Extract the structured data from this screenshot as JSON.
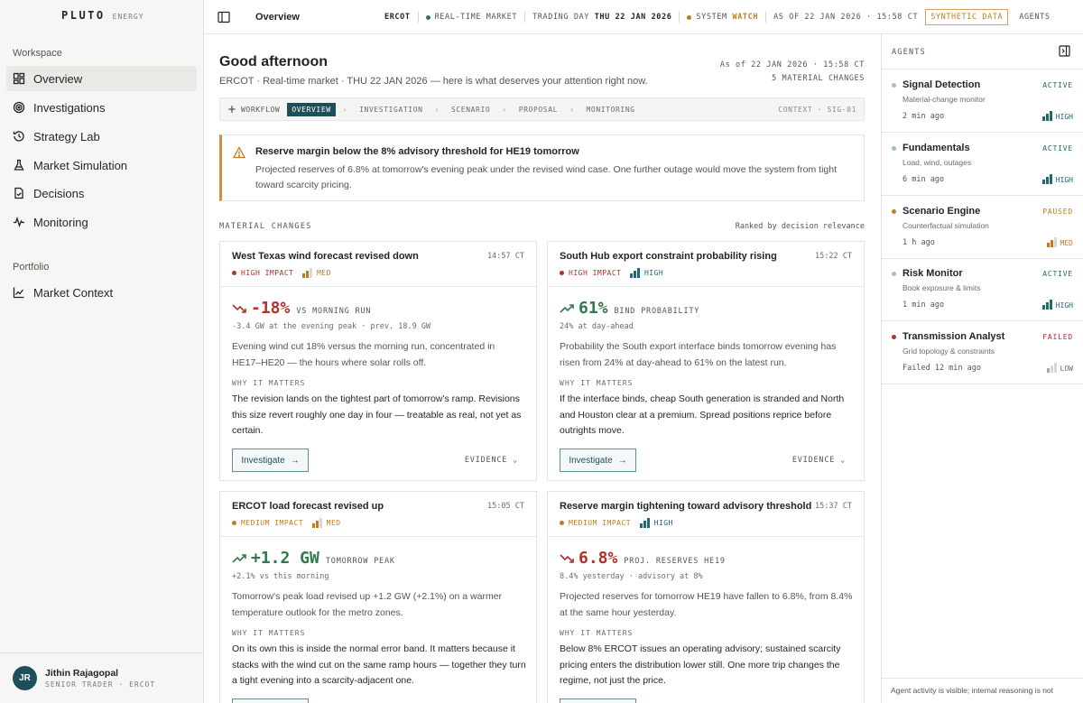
{
  "brand": {
    "name": "PLUTO",
    "sub": "ENERGY"
  },
  "sidebar": {
    "workspace_label": "Workspace",
    "portfolio_label": "Portfolio",
    "items": [
      {
        "label": "Overview",
        "icon": "grid-icon"
      },
      {
        "label": "Investigations",
        "icon": "target-icon"
      },
      {
        "label": "Strategy Lab",
        "icon": "history-icon"
      },
      {
        "label": "Market Simulation",
        "icon": "flask-icon"
      },
      {
        "label": "Decisions",
        "icon": "document-check-icon"
      },
      {
        "label": "Monitoring",
        "icon": "pulse-icon"
      }
    ],
    "portfolio_items": [
      {
        "label": "Market Context",
        "icon": "line-chart-icon"
      }
    ],
    "user": {
      "initials": "JR",
      "name": "Jithin Rajagopal",
      "role": "SENIOR TRADER · ERCOT"
    }
  },
  "topbar": {
    "title": "Overview",
    "market": "ERCOT",
    "realtime": "REAL-TIME MARKET",
    "trading_day_label": "TRADING DAY",
    "trading_day": "THU 22 JAN 2026",
    "system_label": "SYSTEM",
    "system_state": "WATCH",
    "as_of": "AS OF 22 JAN 2026 · 15:58 CT",
    "synthetic": "SYNTHETIC DATA",
    "agents": "AGENTS",
    "colors": {
      "live": "#2d7a4a",
      "watch": "#c07d1e"
    }
  },
  "main": {
    "greeting": "Good afternoon",
    "subtitle": "ERCOT · Real-time market · THU 22 JAN 2026 — here is what deserves your attention right now.",
    "as_of": "As of 22 JAN 2026 · 15:58 CT",
    "changes_count": "5 MATERIAL CHANGES",
    "workflow": {
      "label": "WORKFLOW",
      "steps": [
        "OVERVIEW",
        "INVESTIGATION",
        "SCENARIO",
        "PROPOSAL",
        "MONITORING"
      ],
      "context": "CONTEXT · SIG-01"
    },
    "alert": {
      "title": "Reserve margin below the 8% advisory threshold for HE19 tomorrow",
      "body": "Projected reserves of 6.8% at tomorrow's evening peak under the revised wind case. One further outage would move the system from tight toward scarcity pricing."
    },
    "section_title": "MATERIAL CHANGES",
    "section_sort": "Ranked by decision relevance",
    "why_label": "WHY IT MATTERS",
    "investigate_label": "Investigate",
    "evidence_label": "EVIDENCE",
    "cards": [
      {
        "title": "West Texas wind forecast revised down",
        "time": "14:57 CT",
        "impact": "HIGH IMPACT",
        "signal": "MED",
        "signal_level": 2,
        "trend": "down",
        "value": "-18%",
        "metric_label": "VS MORNING RUN",
        "metric_sub": "-3.4 GW at the evening peak · prev. 18.9 GW",
        "desc": "Evening wind cut 18% versus the morning run, concentrated in HE17–HE20 — the hours where solar rolls off.",
        "why": "The revision lands on the tightest part of tomorrow's ramp. Revisions this size revert roughly one day in four — treatable as real, not yet as certain."
      },
      {
        "title": "South Hub export constraint probability rising",
        "time": "15:22 CT",
        "impact": "HIGH IMPACT",
        "signal": "HIGH",
        "signal_level": 3,
        "trend": "up",
        "value": "61%",
        "metric_label": "BIND PROBABILITY",
        "metric_sub": "24% at day-ahead",
        "desc": "Probability the South export interface binds tomorrow evening has risen from 24% at day-ahead to 61% on the latest run.",
        "why": "If the interface binds, cheap South generation is stranded and North and Houston clear at a premium. Spread positions reprice before outrights move."
      },
      {
        "title": "ERCOT load forecast revised up",
        "time": "15:05 CT",
        "impact": "MEDIUM IMPACT",
        "signal": "MED",
        "signal_level": 2,
        "trend": "up",
        "value": "+1.2 GW",
        "metric_label": "TOMORROW PEAK",
        "metric_sub": "+2.1% vs this morning",
        "desc": "Tomorrow's peak load revised up +1.2 GW (+2.1%) on a warmer temperature outlook for the metro zones.",
        "why": "On its own this is inside the normal error band. It matters because it stacks with the wind cut on the same ramp hours — together they turn a tight evening into a scarcity-adjacent one."
      },
      {
        "title": "Reserve margin tightening toward advisory threshold",
        "time": "15:37 CT",
        "impact": "MEDIUM IMPACT",
        "signal": "HIGH",
        "signal_level": 3,
        "trend": "down",
        "value": "6.8%",
        "metric_label": "PROJ. RESERVES HE19",
        "metric_sub": "8.4% yesterday · advisory at 8%",
        "desc": "Projected reserves for tomorrow HE19 have fallen to 6.8%, from 8.4% at the same hour yesterday.",
        "why": "Below 8% ERCOT issues an operating advisory; sustained scarcity pricing enters the distribution lower still. One more trip changes the regime, not just the price."
      }
    ]
  },
  "agents": {
    "title": "AGENTS",
    "items": [
      {
        "name": "Signal Detection",
        "desc": "Material-change monitor",
        "time": "2 min ago",
        "state": "ACTIVE",
        "signal": "HIGH",
        "signal_level": 3
      },
      {
        "name": "Fundamentals",
        "desc": "Load, wind, outages",
        "time": "6 min ago",
        "state": "ACTIVE",
        "signal": "HIGH",
        "signal_level": 3
      },
      {
        "name": "Scenario Engine",
        "desc": "Counterfactual simulation",
        "time": "1 h ago",
        "state": "PAUSED",
        "signal": "MED",
        "signal_level": 2
      },
      {
        "name": "Risk Monitor",
        "desc": "Book exposure & limits",
        "time": "1 min ago",
        "state": "ACTIVE",
        "signal": "HIGH",
        "signal_level": 3
      },
      {
        "name": "Transmission Analyst",
        "desc": "Grid topology & constraints",
        "time": "Failed 12 min ago",
        "state": "FAILED",
        "signal": "LOW",
        "signal_level": 1
      }
    ],
    "footer": "Agent activity is visible; internal reasoning is not",
    "state_colors": {
      "ACTIVE": "#1d6a75",
      "PAUSED": "#c07d1e",
      "FAILED": "#b3302b"
    },
    "dot_colors": {
      "ACTIVE": "#9cc2c0",
      "PAUSED": "#c07d1e",
      "FAILED": "#b3302b"
    }
  }
}
